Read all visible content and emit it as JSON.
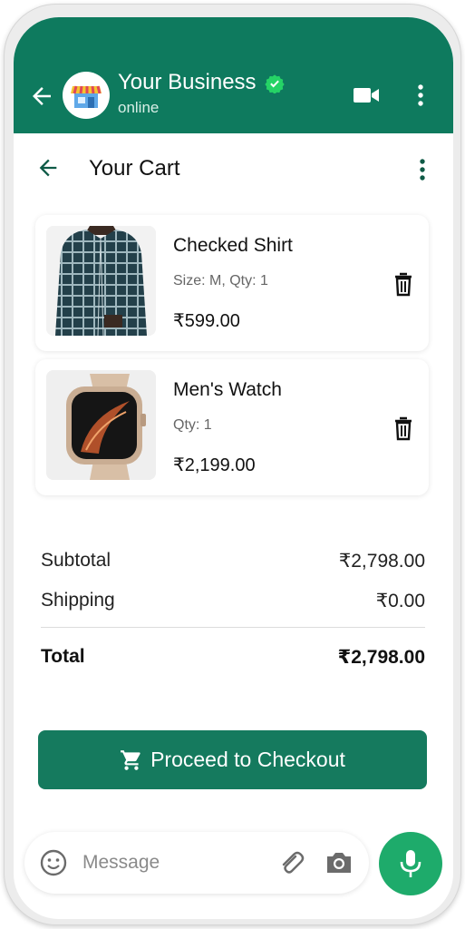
{
  "header": {
    "name": "Your Business",
    "status": "online",
    "icons": [
      "back-arrow-icon",
      "store-avatar",
      "verified-badge-icon",
      "video-call-icon",
      "more-vert-icon"
    ],
    "brand_color": "#0e7a5e"
  },
  "cart": {
    "title": "Your Cart",
    "items": [
      {
        "name": "Checked Shirt",
        "meta": "Size: M, Qty: 1",
        "price": "₹599.00",
        "image": "checked-shirt-image"
      },
      {
        "name": "Men's Watch",
        "meta": "Qty: 1",
        "price": "₹2,199.00",
        "image": "mens-watch-image"
      }
    ]
  },
  "summary": {
    "subtotal_label": "Subtotal",
    "subtotal_value": "₹2,798.00",
    "shipping_label": "Shipping",
    "shipping_value": "₹0.00",
    "total_label": "Total",
    "total_value": "₹2,798.00"
  },
  "checkout": {
    "label": "Proceed to Checkout",
    "color": "#157a5e"
  },
  "composer": {
    "placeholder": "Message",
    "icons": [
      "emoji-icon",
      "attach-icon",
      "camera-icon",
      "mic-icon"
    ],
    "mic_color": "#1eab6b"
  }
}
